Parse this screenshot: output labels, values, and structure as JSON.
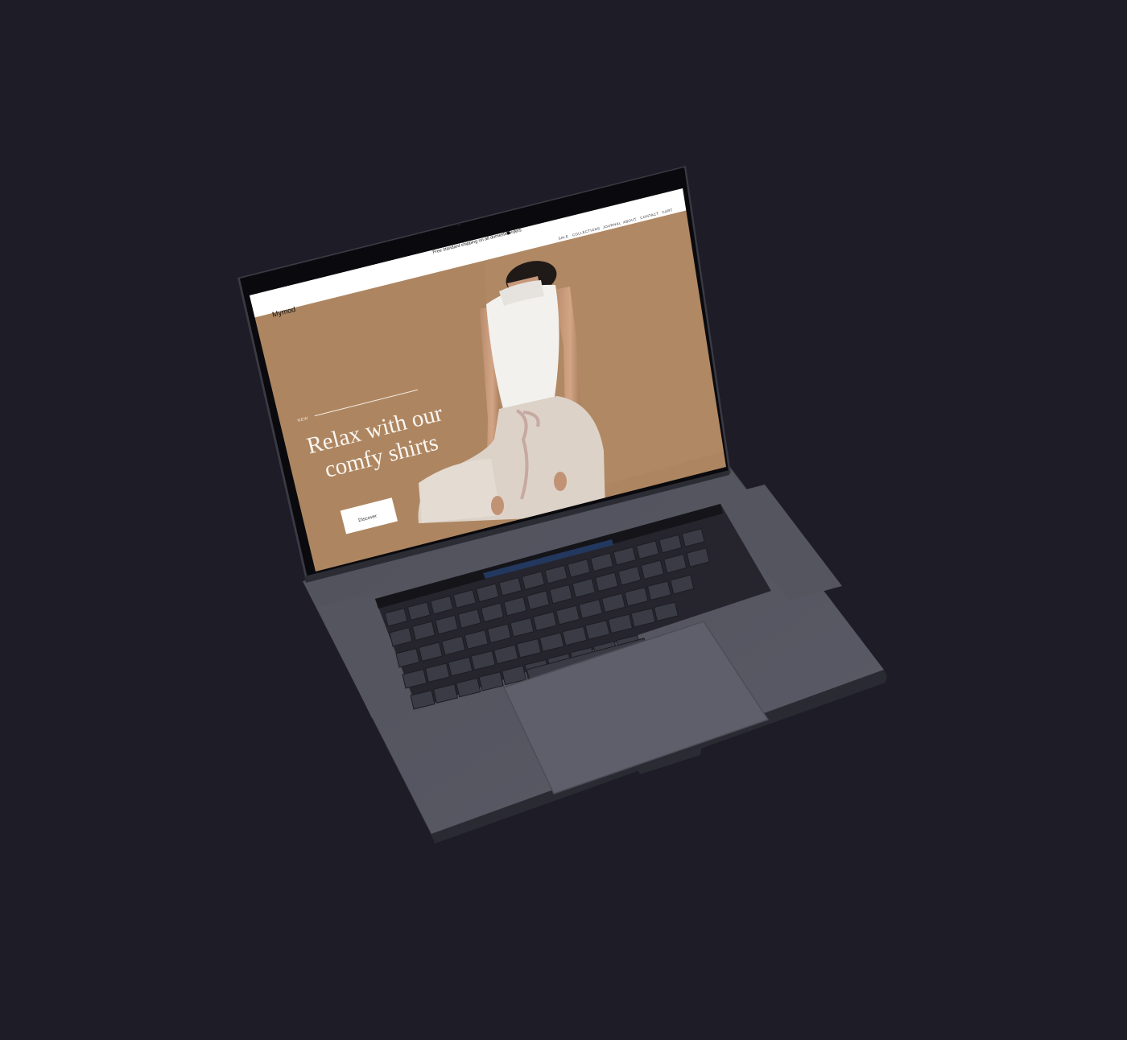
{
  "device": {
    "type": "laptop mockup",
    "body_color": "#4a4a55",
    "background_color": "#1d1c27"
  },
  "website": {
    "announcement": "Free standard shipping on all domestic orders",
    "announcement_icon": "dot-icon",
    "logo": "Mymod",
    "nav": [
      {
        "label": "SALE"
      },
      {
        "label": "COLLECTIONS"
      },
      {
        "label": "JOURNAL"
      },
      {
        "label": "ABOUT"
      },
      {
        "label": "CONTACT"
      },
      {
        "label": "CART"
      }
    ],
    "hero": {
      "eyebrow": "NEW",
      "title_line1": "Relax with our",
      "title_line2": "comfy shirts",
      "cta_label": "Discover",
      "background_color": "#ad8661"
    }
  }
}
